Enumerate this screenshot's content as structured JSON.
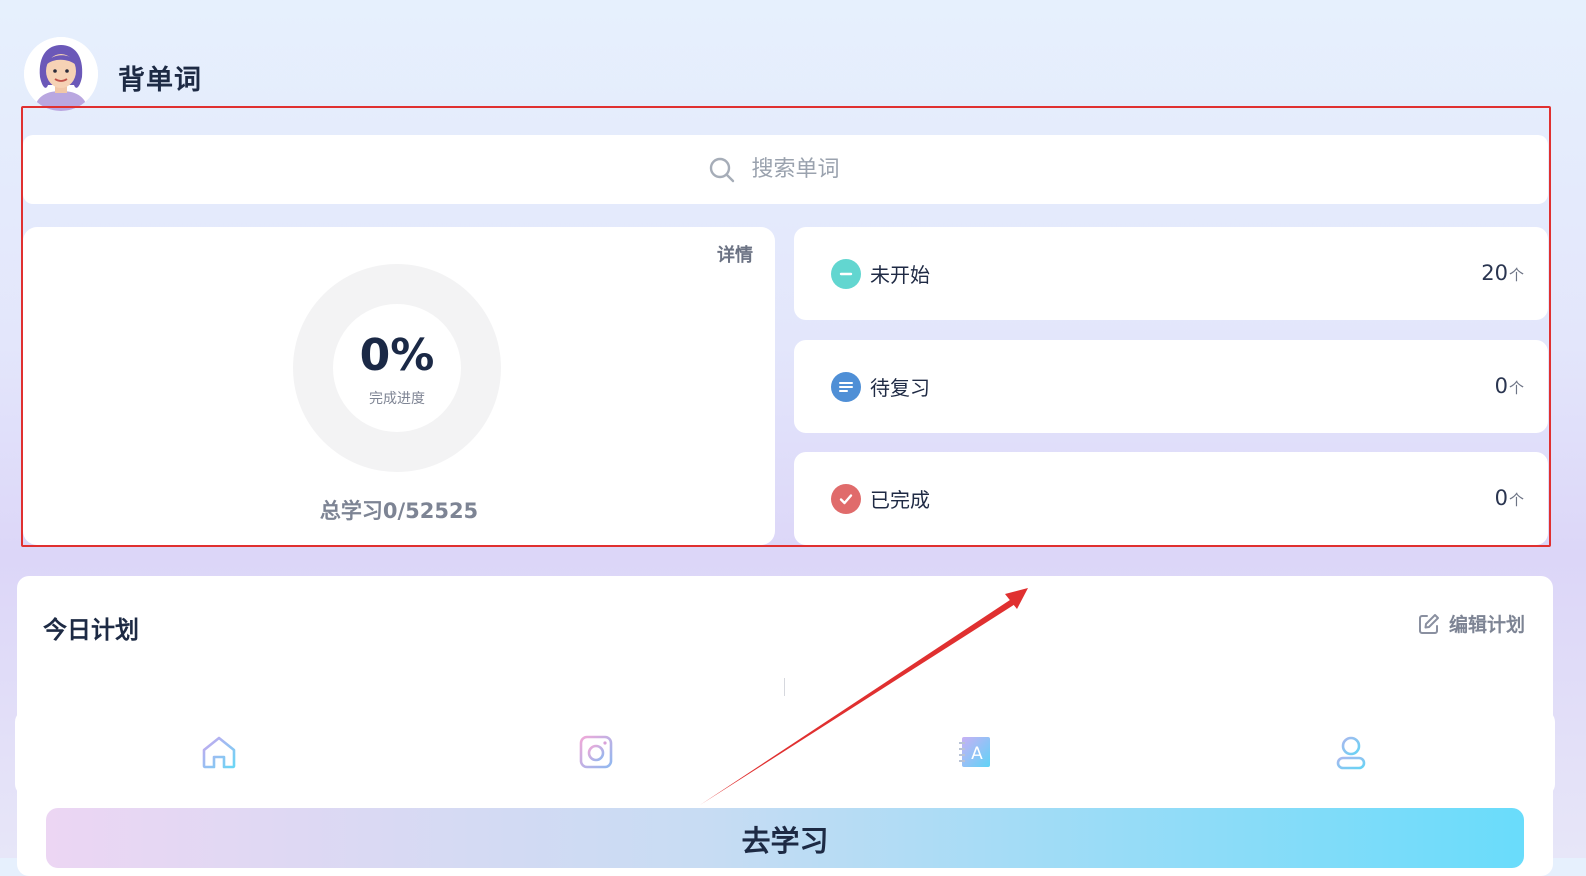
{
  "header": {
    "title": "背单词",
    "avatar_icon": "girl-avatar-icon"
  },
  "search": {
    "placeholder": "搜索单词",
    "icon": "search-icon"
  },
  "progress": {
    "detail_label": "详情",
    "percent_text": "0%",
    "percent_value": 0,
    "label": "完成进度",
    "total_text": "总学习0/52525"
  },
  "stats": [
    {
      "label": "未开始",
      "count": "20",
      "unit": "个",
      "color": "#62d6d0",
      "icon": "minus-icon"
    },
    {
      "label": "待复习",
      "count": "0",
      "unit": "个",
      "color": "#4f8fd6",
      "icon": "list-icon"
    },
    {
      "label": "已完成",
      "count": "0",
      "unit": "个",
      "color": "#e06b6b",
      "icon": "check-icon"
    }
  ],
  "plan": {
    "title": "今日计划",
    "edit_label": "编辑计划",
    "edit_icon": "edit-icon"
  },
  "tabbar": [
    {
      "name": "home",
      "icon": "home-icon"
    },
    {
      "name": "camera",
      "icon": "camera-icon"
    },
    {
      "name": "translate",
      "icon": "translate-icon",
      "glyph": "A"
    },
    {
      "name": "profile",
      "icon": "user-icon"
    }
  ],
  "start_button": {
    "label": "去学习"
  },
  "colors": {
    "highlight_box": "#e03030",
    "annotation_arrow": "#e03030"
  }
}
